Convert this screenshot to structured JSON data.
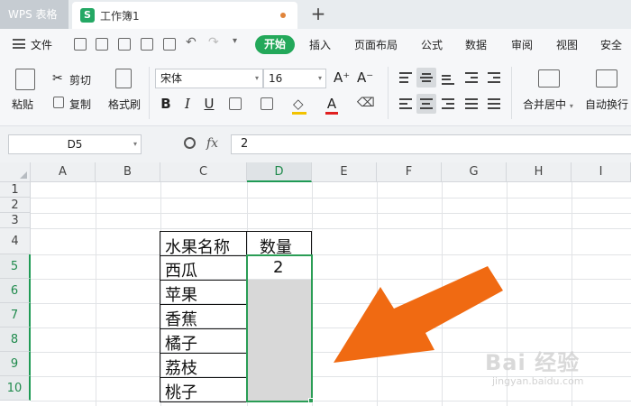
{
  "titlebar": {
    "app_name": "WPS 表格",
    "doc_title": "工作簿1",
    "doc_icon_letter": "S",
    "new_tab": "+"
  },
  "menubar": {
    "file": "文件",
    "active_tab": "开始",
    "items": [
      "插入",
      "页面布局",
      "公式",
      "数据",
      "审阅",
      "视图",
      "安全"
    ]
  },
  "ribbon": {
    "paste": "粘贴",
    "cut": "剪切",
    "copy": "复制",
    "format_painter": "格式刷",
    "font_name": "宋体",
    "font_size": "16",
    "grow_font": "A⁺",
    "shrink_font": "A⁻",
    "bold": "B",
    "italic": "I",
    "underline": "U",
    "font_color_glyph": "A",
    "merge_center": "合并居中",
    "wrap_text": "自动换行"
  },
  "formulabar": {
    "name_box": "D5",
    "fx": "fx",
    "formula": "2"
  },
  "sheet": {
    "columns": [
      "A",
      "B",
      "C",
      "D",
      "E",
      "F",
      "G",
      "H",
      "I"
    ],
    "rows": [
      "1",
      "2",
      "3",
      "4",
      "5",
      "6",
      "7",
      "8",
      "9",
      "10"
    ],
    "selected_column": "D",
    "table_header": [
      "水果名称",
      "数量"
    ],
    "fruits": [
      "西瓜",
      "苹果",
      "香蕉",
      "橘子",
      "荔枝",
      "桃子"
    ],
    "quantity_d5": "2"
  },
  "colors": {
    "accent_green": "#23a85a",
    "arrow_orange": "#f06a12",
    "selection_fill": "#d8d8d8"
  },
  "watermark": {
    "brand": "Bai 经验",
    "url": "jingyan.baidu.com"
  }
}
